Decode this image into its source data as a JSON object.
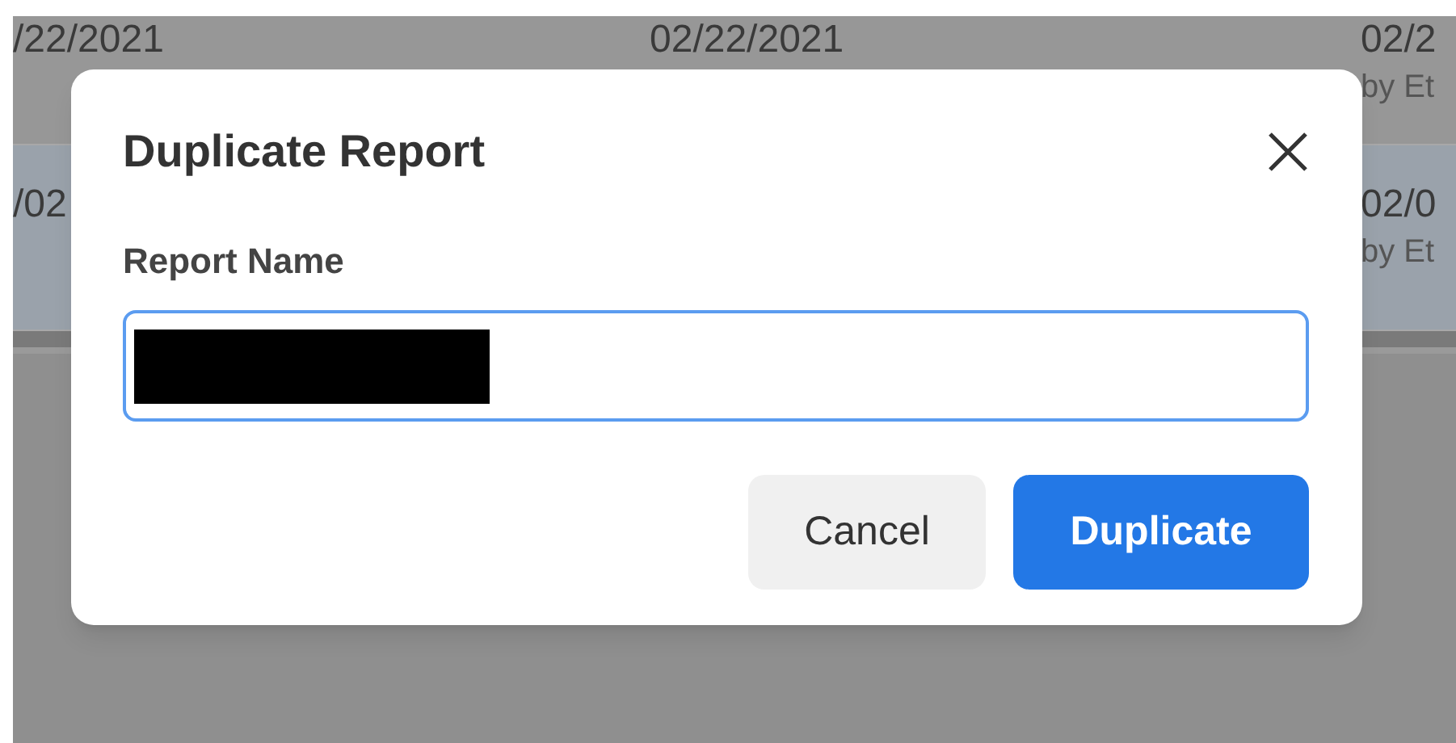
{
  "background_table": {
    "rows": [
      {
        "selected": false,
        "cells": [
          {
            "date": "/22/2021"
          },
          {
            "date": "02/22/2021"
          },
          {
            "date": "02/2",
            "byline": "by Et"
          }
        ]
      },
      {
        "selected": true,
        "cells": [
          {
            "date": "/02"
          },
          {},
          {
            "date": "02/0",
            "byline": "by Et"
          }
        ]
      }
    ]
  },
  "dialog": {
    "title": "Duplicate Report",
    "field": {
      "label": "Report Name",
      "redacted": true,
      "focused": true
    },
    "buttons": [
      {
        "label": "Cancel",
        "kind": "secondary"
      },
      {
        "label": "Duplicate",
        "kind": "primary"
      }
    ]
  }
}
